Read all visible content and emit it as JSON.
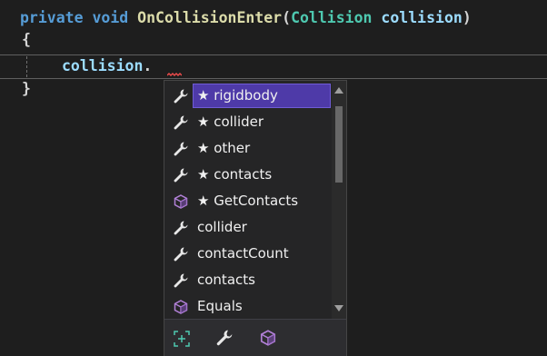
{
  "code": {
    "line1": {
      "kw_private": "private",
      "kw_void": "void",
      "method_name": "OnCollisionEnter",
      "open_paren": "(",
      "param_type": "Collision",
      "param_name": "collision",
      "close_paren": ")"
    },
    "line2_brace": "{",
    "line3": {
      "identifier": "collision",
      "dot": "."
    },
    "line4_brace": "}"
  },
  "completion": {
    "selected_index": 0,
    "items": [
      {
        "icon": "wrench-icon",
        "label": "★ rigidbody"
      },
      {
        "icon": "wrench-icon",
        "label": "★ collider"
      },
      {
        "icon": "wrench-icon",
        "label": "★ other"
      },
      {
        "icon": "wrench-icon",
        "label": "★ contacts"
      },
      {
        "icon": "method-cube-icon",
        "label": "★ GetContacts"
      },
      {
        "icon": "wrench-icon",
        "label": "collider"
      },
      {
        "icon": "wrench-icon",
        "label": "contactCount"
      },
      {
        "icon": "wrench-icon",
        "label": "contacts"
      },
      {
        "icon": "method-cube-icon",
        "label": "Equals"
      }
    ],
    "filters": [
      {
        "icon": "expand-filter-icon"
      },
      {
        "icon": "wrench-icon"
      },
      {
        "icon": "method-cube-icon"
      }
    ]
  },
  "colors": {
    "background": "#1e1e1e",
    "keyword": "#569cd6",
    "method": "#dcdcaa",
    "type": "#4ec9b0",
    "identifier": "#9cdcfe",
    "selection": "#4e3aa8",
    "method_icon": "#b180d7",
    "squiggle": "#f14c4c"
  }
}
